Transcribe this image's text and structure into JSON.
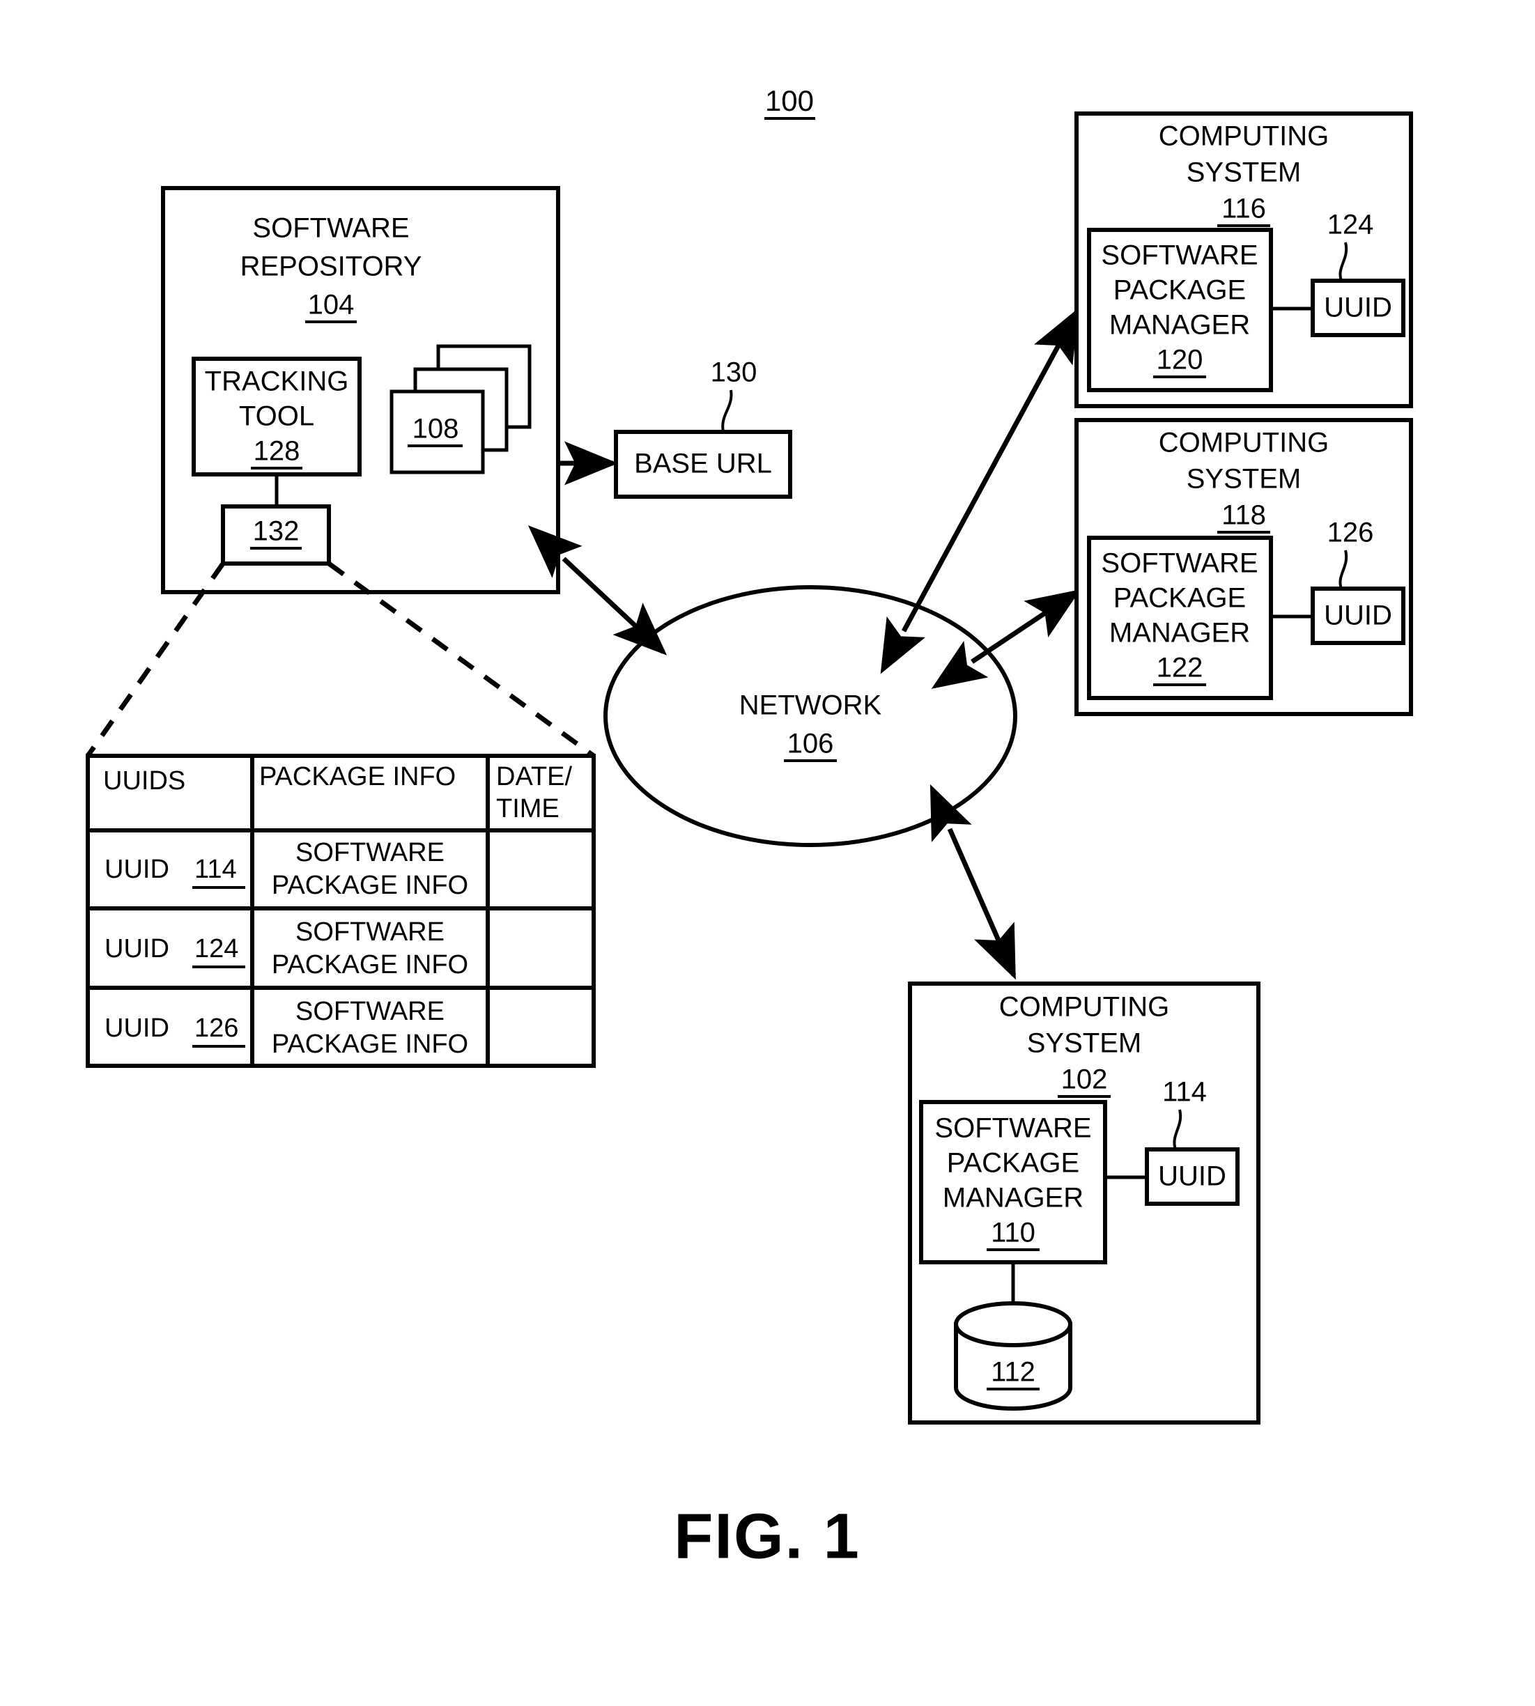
{
  "figure": {
    "caption": "FIG. 1",
    "system_ref": "100"
  },
  "repository": {
    "title_line1": "SOFTWARE",
    "title_line2": "REPOSITORY",
    "ref": "104",
    "tracking_tool": {
      "line1": "TRACKING",
      "line2": "TOOL",
      "ref": "128"
    },
    "records_box_ref": "132",
    "packages_ref": "108"
  },
  "base_url": {
    "label": "BASE URL",
    "ref": "130"
  },
  "network": {
    "label": "NETWORK",
    "ref": "106"
  },
  "table": {
    "headers": [
      "UUIDS",
      "PACKAGE INFO",
      "DATE/",
      "TIME"
    ],
    "header_col1": "UUIDS",
    "header_col2": "PACKAGE INFO",
    "header_col3_line1": "DATE/",
    "header_col3_line2": "TIME",
    "rows": [
      {
        "uuid_label": "UUID",
        "uuid_ref": "114",
        "info_line1": "SOFTWARE",
        "info_line2": "PACKAGE INFO",
        "datetime": ""
      },
      {
        "uuid_label": "UUID",
        "uuid_ref": "124",
        "info_line1": "SOFTWARE",
        "info_line2": "PACKAGE INFO",
        "datetime": ""
      },
      {
        "uuid_label": "UUID",
        "uuid_ref": "126",
        "info_line1": "SOFTWARE",
        "info_line2": "PACKAGE INFO",
        "datetime": ""
      }
    ]
  },
  "computing_systems": [
    {
      "title_line1": "COMPUTING",
      "title_line2": "SYSTEM",
      "ref": "116",
      "manager": {
        "line1": "SOFTWARE",
        "line2": "PACKAGE",
        "line3": "MANAGER",
        "ref": "120"
      },
      "uuid": {
        "label": "UUID",
        "ref": "124"
      }
    },
    {
      "title_line1": "COMPUTING",
      "title_line2": "SYSTEM",
      "ref": "118",
      "manager": {
        "line1": "SOFTWARE",
        "line2": "PACKAGE",
        "line3": "MANAGER",
        "ref": "122"
      },
      "uuid": {
        "label": "UUID",
        "ref": "126"
      }
    },
    {
      "title_line1": "COMPUTING",
      "title_line2": "SYSTEM",
      "ref": "102",
      "manager": {
        "line1": "SOFTWARE",
        "line2": "PACKAGE",
        "line3": "MANAGER",
        "ref": "110"
      },
      "uuid": {
        "label": "UUID",
        "ref": "114"
      },
      "datastore": {
        "ref": "112"
      }
    }
  ],
  "colors": {
    "stroke": "#000000",
    "fill": "#ffffff"
  }
}
